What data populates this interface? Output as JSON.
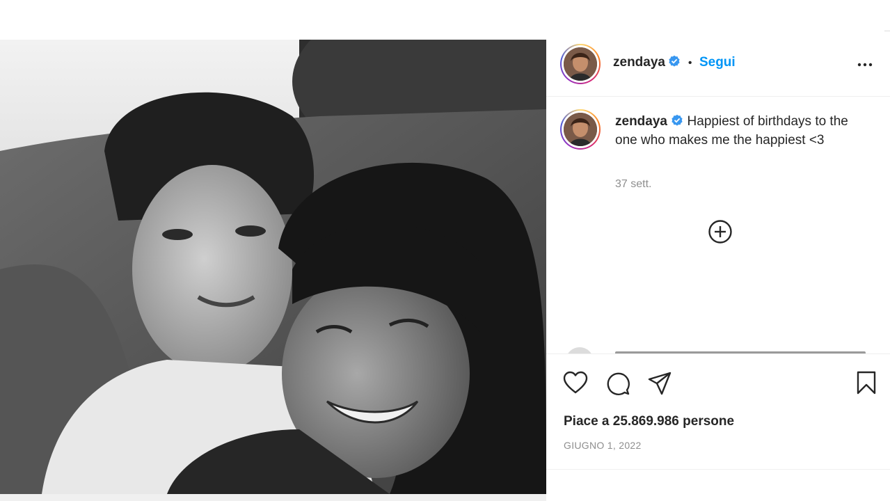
{
  "post": {
    "author": "zendaya",
    "verified_icon": "verified-badge-icon",
    "follow_label": "Segui",
    "separator": "•",
    "more_icon": "more-options-icon"
  },
  "caption": {
    "username": "zendaya",
    "text": "Happiest of birthdays to the one who makes me the happiest <3",
    "time_ago": "37 sett."
  },
  "comments": {
    "load_more_icon": "plus-circle-icon"
  },
  "actions": {
    "like_icon": "heart-icon",
    "comment_icon": "comment-icon",
    "share_icon": "send-icon",
    "save_icon": "bookmark-icon",
    "likes_text": "Piace a 25.869.986 persone",
    "date": "GIUGNO 1, 2022"
  },
  "colors": {
    "accent": "#0095f6",
    "verified": "#3897f0",
    "text": "#262626",
    "muted": "#8e8e8e"
  }
}
